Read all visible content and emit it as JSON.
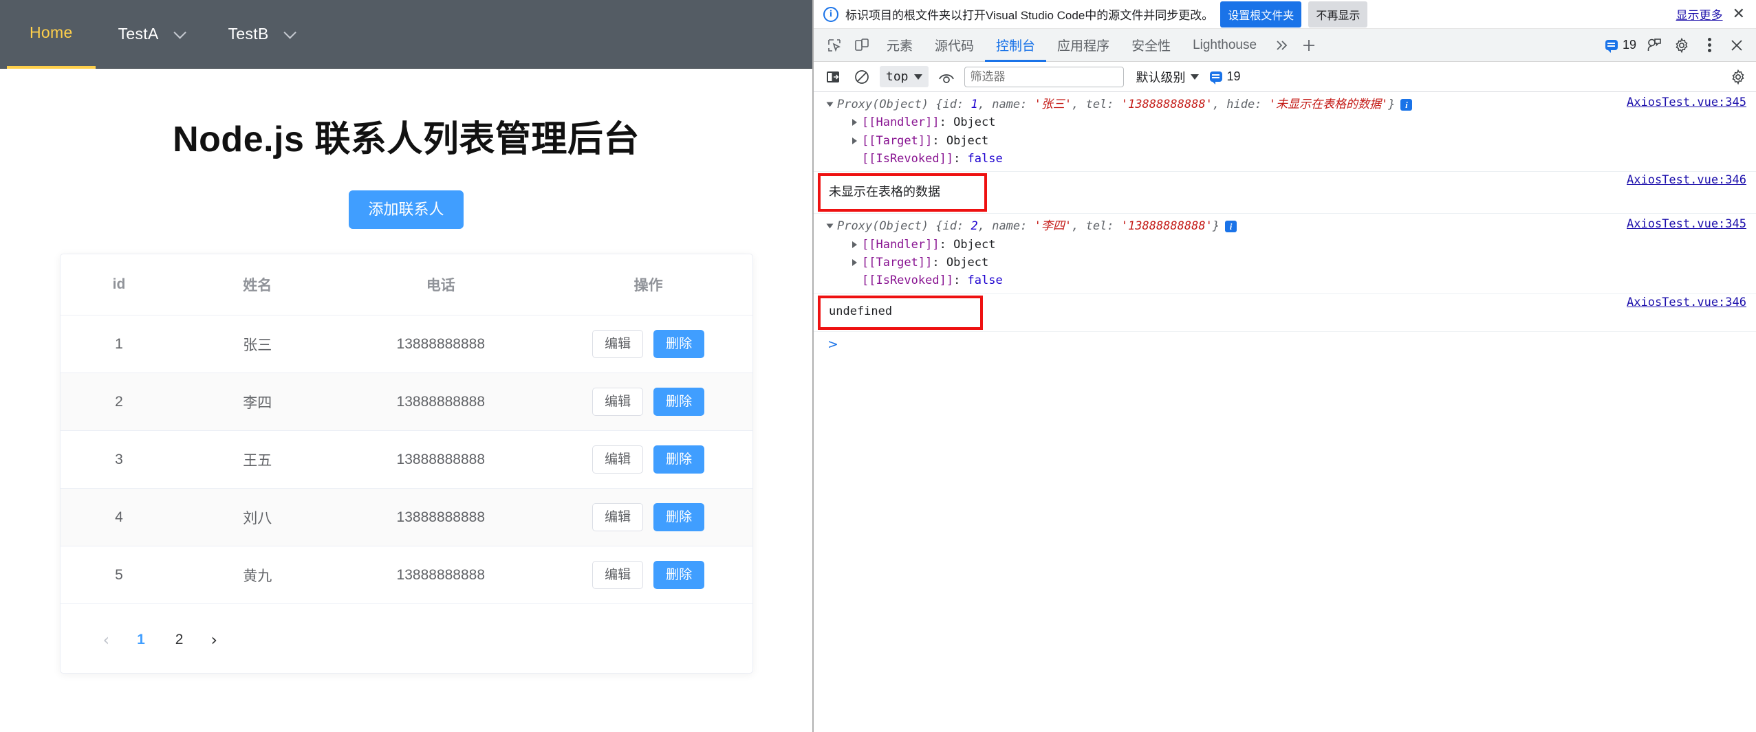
{
  "webpage": {
    "nav": {
      "items": [
        {
          "label": "Home",
          "active": true,
          "has_caret": false
        },
        {
          "label": "TestA",
          "active": false,
          "has_caret": true
        },
        {
          "label": "TestB",
          "active": false,
          "has_caret": true
        }
      ]
    },
    "title": "Node.js 联系人列表管理后台",
    "add_button": "添加联系人",
    "table": {
      "headers": [
        "id",
        "姓名",
        "电话",
        "操作"
      ],
      "rows": [
        {
          "id": "1",
          "name": "张三",
          "tel": "13888888888",
          "edit": "编辑",
          "delete": "删除"
        },
        {
          "id": "2",
          "name": "李四",
          "tel": "13888888888",
          "edit": "编辑",
          "delete": "删除"
        },
        {
          "id": "3",
          "name": "王五",
          "tel": "13888888888",
          "edit": "编辑",
          "delete": "删除"
        },
        {
          "id": "4",
          "name": "刘八",
          "tel": "13888888888",
          "edit": "编辑",
          "delete": "删除"
        },
        {
          "id": "5",
          "name": "黄九",
          "tel": "13888888888",
          "edit": "编辑",
          "delete": "删除"
        }
      ]
    },
    "pagination": {
      "prev": "‹",
      "next": "›",
      "pages": [
        "1",
        "2"
      ],
      "current": "1"
    },
    "colors": {
      "nav_bg": "#545c64",
      "nav_active": "#ffd04b",
      "primary": "#409eff"
    }
  },
  "devtools": {
    "infobar": {
      "message": "标识项目的根文件夹以打开Visual Studio Code中的源文件并同步更改。",
      "primary_button": "设置根文件夹",
      "secondary_button": "不再显示",
      "more_link": "显示更多",
      "close": "✕"
    },
    "tabs": [
      {
        "label": "元素",
        "active": false
      },
      {
        "label": "源代码",
        "active": false
      },
      {
        "label": "控制台",
        "active": true
      },
      {
        "label": "应用程序",
        "active": false
      },
      {
        "label": "安全性",
        "active": false
      },
      {
        "label": "Lighthouse",
        "active": false
      }
    ],
    "tabbar_right": {
      "more_tabs": "»",
      "add_tab": "+",
      "message_count": "19"
    },
    "console_toolbar": {
      "context": "top",
      "filter_placeholder": "筛选器",
      "level": "默认级别",
      "message_count": "19"
    },
    "console_logs": [
      {
        "type": "object",
        "header_prefix": "Proxy(Object) ",
        "parts": [
          {
            "t": "{id: ",
            "c": "grey-ital"
          },
          {
            "t": "1",
            "c": "blue-ital"
          },
          {
            "t": ", name: ",
            "c": "grey-ital"
          },
          {
            "t": "'张三'",
            "c": "red-ital"
          },
          {
            "t": ", tel: ",
            "c": "grey-ital"
          },
          {
            "t": "'13888888888'",
            "c": "red-ital"
          },
          {
            "t": ", hide: ",
            "c": "grey-ital"
          },
          {
            "t": "'未显示在表格的数据'",
            "c": "red-ital"
          },
          {
            "t": "}",
            "c": "grey-ital"
          }
        ],
        "props": [
          {
            "key": "[[Handler]]",
            "value": "Object",
            "expandable": true
          },
          {
            "key": "[[Target]]",
            "value": "Object",
            "expandable": true
          },
          {
            "key": "[[IsRevoked]]",
            "value": "false",
            "expandable": false
          }
        ],
        "source": "AxiosTest.vue:345"
      },
      {
        "type": "boxed-text",
        "text": "未显示在表格的数据",
        "source": "AxiosTest.vue:346"
      },
      {
        "type": "object",
        "header_prefix": "Proxy(Object) ",
        "parts": [
          {
            "t": "{id: ",
            "c": "grey-ital"
          },
          {
            "t": "2",
            "c": "blue-ital"
          },
          {
            "t": ", name: ",
            "c": "grey-ital"
          },
          {
            "t": "'李四'",
            "c": "red-ital"
          },
          {
            "t": ", tel: ",
            "c": "grey-ital"
          },
          {
            "t": "'13888888888'",
            "c": "red-ital"
          },
          {
            "t": "}",
            "c": "grey-ital"
          }
        ],
        "props": [
          {
            "key": "[[Handler]]",
            "value": "Object",
            "expandable": true
          },
          {
            "key": "[[Target]]",
            "value": "Object",
            "expandable": true
          },
          {
            "key": "[[IsRevoked]]",
            "value": "false",
            "expandable": false
          }
        ],
        "source": "AxiosTest.vue:345"
      },
      {
        "type": "boxed-text",
        "text": "undefined",
        "mono": true,
        "source": "AxiosTest.vue:346"
      }
    ],
    "prompt": ">"
  }
}
